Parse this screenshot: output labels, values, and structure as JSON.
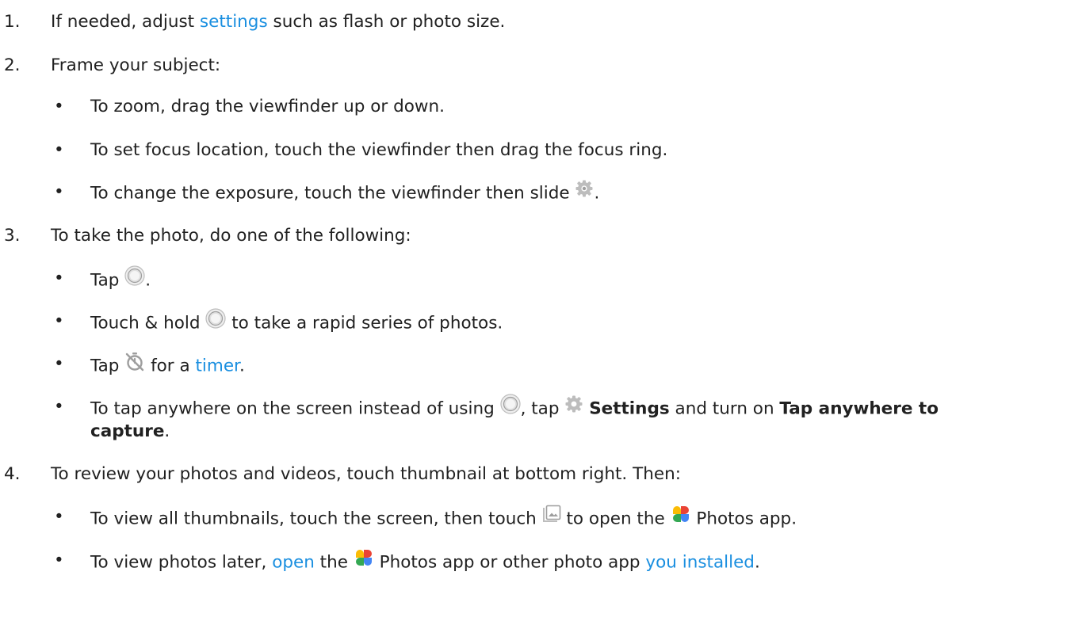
{
  "steps": [
    {
      "number": "1.",
      "t1": "If needed, adjust ",
      "link": "settings",
      "t2": " such as flash or photo size."
    },
    {
      "number": "2.",
      "text": "Frame your subject:",
      "bullets": [
        {
          "text": "To zoom, drag the viewfinder up or down."
        },
        {
          "text": "To set focus location, touch the viewfinder then drag the focus ring."
        },
        {
          "t1": "To change the exposure, touch the viewfinder then slide ",
          "icon": "exposure-gear-icon",
          "t2": "."
        }
      ]
    },
    {
      "number": "3.",
      "text": "To take the photo, do one of the following:",
      "bullets": [
        {
          "t1": "Tap ",
          "icon": "shutter-icon",
          "t2": "."
        },
        {
          "t1": "Touch & hold ",
          "icon": "shutter-icon",
          "t2": " to take a rapid series of photos."
        },
        {
          "t1": "Tap ",
          "icon": "timer-off-icon",
          "t2": " for a ",
          "link": "timer",
          "t3": "."
        },
        {
          "t1": "To tap anywhere on the screen instead of using ",
          "t2": ", tap ",
          "bold1": "Settings",
          "t3": " and turn on ",
          "bold2a": "Tap anywhere to",
          "bold2b": "capture",
          "t4": "."
        }
      ]
    },
    {
      "number": "4.",
      "text": "To review your photos and videos, touch thumbnail at bottom right. Then:",
      "bullets": [
        {
          "t1": "To view all thumbnails, touch the screen, then touch ",
          "t2": " to open the ",
          "t3": " Photos app."
        },
        {
          "t1": "To view photos later, ",
          "link1": "open",
          "t2": " the ",
          "t3": " Photos app or other photo app ",
          "link2": "you installed",
          "t4": "."
        }
      ]
    }
  ],
  "bullet_char": "•",
  "colors": {
    "text": "#212121",
    "link": "#1a8fe0",
    "icon_gray": "#bdbdbd"
  }
}
